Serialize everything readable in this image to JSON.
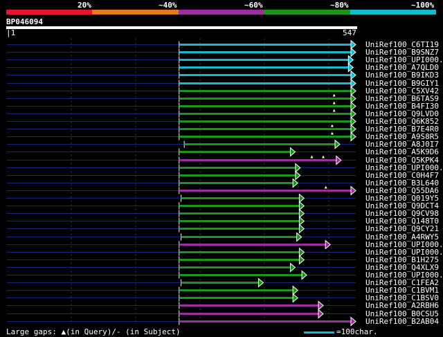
{
  "header": {
    "scale": [
      {
        "label": "20%",
        "color": "#e8162d"
      },
      {
        "label": "~40%",
        "color": "#e47b1a"
      },
      {
        "label": "~60%",
        "color": "#9b2f9e"
      },
      {
        "label": "~80%",
        "color": "#189818"
      },
      {
        "label": "~100%",
        "color": "#17b9cf"
      }
    ],
    "query_id": "BP046094",
    "query_start": "1",
    "query_end": "547"
  },
  "axis": {
    "query_length": 547
  },
  "hits": [
    {
      "label": "UniRef100_C6TI19",
      "color": "cyan",
      "start": 270,
      "end": 547,
      "markers": []
    },
    {
      "label": "UniRef100_B9SNZ7",
      "color": "cyan",
      "start": 270,
      "end": 547,
      "markers": []
    },
    {
      "label": "UniRef100_UPI000..",
      "color": "cyan",
      "start": 270,
      "end": 543,
      "markers": []
    },
    {
      "label": "UniRef100_A7QLD0",
      "color": "cyan",
      "start": 270,
      "end": 543,
      "markers": []
    },
    {
      "label": "UniRef100_B9IKD3",
      "color": "cyan",
      "start": 270,
      "end": 547,
      "markers": []
    },
    {
      "label": "UniRef100_B9GIY1",
      "color": "cyan",
      "start": 270,
      "end": 547,
      "markers": []
    },
    {
      "label": "UniRef100_C5XV42",
      "color": "green",
      "start": 270,
      "end": 547,
      "markers": []
    },
    {
      "label": "UniRef100_B6TAS9",
      "color": "green",
      "start": 270,
      "end": 547,
      "markers": [
        513
      ]
    },
    {
      "label": "UniRef100_B4FI30",
      "color": "green",
      "start": 270,
      "end": 547,
      "markers": [
        513
      ]
    },
    {
      "label": "UniRef100_Q9LVD0",
      "color": "green",
      "start": 270,
      "end": 547,
      "markers": [
        513
      ]
    },
    {
      "label": "UniRef100_Q6K852",
      "color": "green",
      "start": 270,
      "end": 547,
      "markers": []
    },
    {
      "label": "UniRef100_B7E4R0",
      "color": "green",
      "start": 270,
      "end": 547,
      "markers": [
        510
      ]
    },
    {
      "label": "UniRef100_A9S8R5",
      "color": "green",
      "start": 270,
      "end": 547,
      "markers": [
        510
      ]
    },
    {
      "label": "UniRef100_A8J0I7",
      "color": "green",
      "start": 278,
      "end": 522,
      "markers": []
    },
    {
      "label": "UniRef100_A5K9D6",
      "color": "green",
      "start": 270,
      "end": 452,
      "markers": []
    },
    {
      "label": "UniRef100_Q5KPK4",
      "color": "purple",
      "start": 270,
      "end": 524,
      "markers": [
        478,
        496
      ]
    },
    {
      "label": "UniRef100_UPI000..",
      "color": "green",
      "start": 270,
      "end": 460,
      "markers": []
    },
    {
      "label": "UniRef100_C0H4F7",
      "color": "green",
      "start": 270,
      "end": 460,
      "markers": []
    },
    {
      "label": "UniRef100_B3L640",
      "color": "green",
      "start": 270,
      "end": 456,
      "markers": []
    },
    {
      "label": "UniRef100_Q55DA6",
      "color": "purple",
      "start": 270,
      "end": 547,
      "markers": [
        500
      ]
    },
    {
      "label": "UniRef100_Q019Y5",
      "color": "green",
      "start": 273,
      "end": 466,
      "markers": []
    },
    {
      "label": "UniRef100_Q9DCT4",
      "color": "green",
      "start": 270,
      "end": 466,
      "markers": []
    },
    {
      "label": "UniRef100_Q9CV98",
      "color": "green",
      "start": 270,
      "end": 466,
      "markers": []
    },
    {
      "label": "UniRef100_Q148T0",
      "color": "green",
      "start": 270,
      "end": 466,
      "markers": []
    },
    {
      "label": "UniRef100_Q9CY21",
      "color": "green",
      "start": 270,
      "end": 466,
      "markers": []
    },
    {
      "label": "UniRef100_A4RWY5",
      "color": "green",
      "start": 273,
      "end": 462,
      "markers": []
    },
    {
      "label": "UniRef100_UPI000..",
      "color": "purple",
      "start": 270,
      "end": 507,
      "markers": []
    },
    {
      "label": "UniRef100_UPI000..",
      "color": "green",
      "start": 270,
      "end": 466,
      "markers": []
    },
    {
      "label": "UniRef100_B1H275",
      "color": "green",
      "start": 270,
      "end": 466,
      "markers": []
    },
    {
      "label": "UniRef100_Q4XLX9",
      "color": "green",
      "start": 270,
      "end": 452,
      "markers": []
    },
    {
      "label": "UniRef100_UPI000..",
      "color": "green",
      "start": 270,
      "end": 470,
      "markers": []
    },
    {
      "label": "UniRef100_C1FEA2",
      "color": "green",
      "start": 273,
      "end": 402,
      "markers": []
    },
    {
      "label": "UniRef100_C1BVM1",
      "color": "green",
      "start": 270,
      "end": 456,
      "markers": []
    },
    {
      "label": "UniRef100_C1BSV0",
      "color": "green",
      "start": 270,
      "end": 456,
      "markers": []
    },
    {
      "label": "UniRef100_A2RBH6",
      "color": "purple",
      "start": 270,
      "end": 496,
      "markers": []
    },
    {
      "label": "UniRef100_B0CSU5",
      "color": "purple",
      "start": 270,
      "end": 496,
      "markers": []
    },
    {
      "label": "UniRef100_B2AB04",
      "color": "purple",
      "start": 270,
      "end": 547,
      "markers": []
    }
  ],
  "colors": {
    "cyan": "#17b9cf",
    "green": "#189818",
    "purple": "#9b2f9e",
    "backbone": "#1a237e",
    "marker": "#ffff99"
  },
  "legend": {
    "large_gaps": "Large gaps: ▲(in Query)/- (in Subject)",
    "scale_note": "=100char."
  }
}
